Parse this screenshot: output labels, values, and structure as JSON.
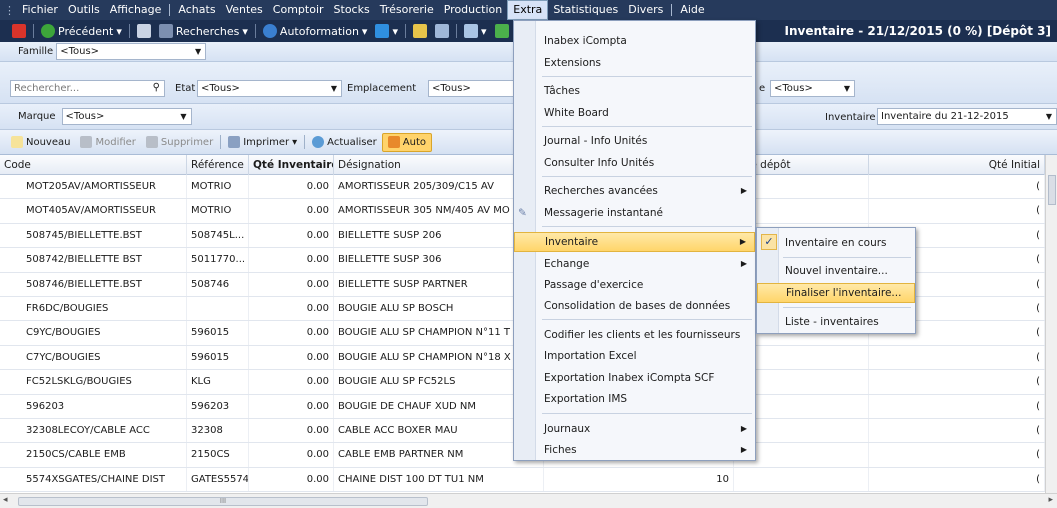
{
  "menubar": {
    "items": [
      "Fichier",
      "Outils",
      "Affichage",
      "Achats",
      "Ventes",
      "Comptoir",
      "Stocks",
      "Trésorerie",
      "Production",
      "Extra",
      "Statistiques",
      "Divers",
      "Aide"
    ]
  },
  "toolbar": {
    "back_label": "Précédent",
    "search_label": "Recherches",
    "autoformation_label": "Autoformation",
    "window_title": "Inventaire - 21/12/2015 (0 %) [Dépôt 3]"
  },
  "filters": {
    "famille_label": "Famille",
    "famille_value": "<Tous>",
    "search_placeholder": "Rechercher...",
    "etat_label": "Etat",
    "etat_value": "<Tous>",
    "emplacement_label": "Emplacement",
    "emplacement_value": "<Tous>",
    "other_value": "<Tous>",
    "marque_label": "Marque",
    "marque_value": "<Tous>",
    "inventaire_label": "Inventaire",
    "inventaire_value": "Inventaire du 21-12-2015"
  },
  "actions": {
    "nouveau": "Nouveau",
    "modifier": "Modifier",
    "supprimer": "Supprimer",
    "imprimer": "Imprimer",
    "actualiser": "Actualiser",
    "auto": "Auto"
  },
  "grid": {
    "headers": {
      "code": "Code",
      "reference": "Référence",
      "qte_inventaire": "Qté Inventaire",
      "designation": "Désignation",
      "qte_depot": "Qté dépôt",
      "qte_initial": "Qté Initial"
    },
    "rows": [
      {
        "code": "MOT205AV/AMORTISSEUR",
        "ref": "MOTRIO",
        "qty": "0.00",
        "des": "AMORTISSEUR 205/309/C15 AV",
        "extra": "",
        "ini": "("
      },
      {
        "code": "MOT405AV/AMORTISSEUR",
        "ref": "MOTRIO",
        "qty": "0.00",
        "des": "AMORTISSEUR 305 NM/405 AV MO",
        "extra": "",
        "ini": "("
      },
      {
        "code": "508745/BIELLETTE.BST",
        "ref": "508745L...",
        "qty": "0.00",
        "des": "BIELLETTE SUSP 206",
        "extra": "",
        "ini": "("
      },
      {
        "code": "508742/BIELLETTE BST",
        "ref": "5011770...",
        "qty": "0.00",
        "des": "BIELLETTE SUSP 306",
        "extra": "",
        "ini": "("
      },
      {
        "code": "508746/BIELLETTE.BST",
        "ref": "508746",
        "qty": "0.00",
        "des": "BIELLETTE SUSP PARTNER",
        "extra": "",
        "ini": "("
      },
      {
        "code": "FR6DC/BOUGIES",
        "ref": "",
        "qty": "0.00",
        "des": "BOUGIE ALU SP BOSCH",
        "extra": "",
        "ini": "("
      },
      {
        "code": "C9YC/BOUGIES",
        "ref": "596015",
        "qty": "0.00",
        "des": "BOUGIE ALU SP CHAMPION N°11 T",
        "extra": "",
        "ini": "("
      },
      {
        "code": "C7YC/BOUGIES",
        "ref": "596015",
        "qty": "0.00",
        "des": "BOUGIE ALU SP CHAMPION N°18 X",
        "extra": "",
        "ini": "("
      },
      {
        "code": "FC52LSKLG/BOUGIES",
        "ref": "KLG",
        "qty": "0.00",
        "des": "BOUGIE ALU SP FC52LS",
        "extra": "",
        "ini": "("
      },
      {
        "code": "596203",
        "ref": "596203",
        "qty": "0.00",
        "des": "BOUGIE DE CHAUF XUD NM",
        "extra": "",
        "ini": "("
      },
      {
        "code": "32308LECOY/CABLE ACC",
        "ref": "32308",
        "qty": "0.00",
        "des": "CABLE ACC BOXER MAU",
        "extra": "",
        "ini": "("
      },
      {
        "code": "2150CS/CABLE EMB",
        "ref": "2150CS",
        "qty": "0.00",
        "des": "CABLE EMB PARTNER NM",
        "extra": "",
        "ini": "("
      },
      {
        "code": "5574XSGATES/CHAINE DIST",
        "ref": "GATES5574",
        "qty": "0.00",
        "des": "CHAINE DIST 100 DT TU1 NM",
        "extra": "10",
        "ini": "("
      }
    ]
  },
  "extra_menu": {
    "items": [
      "Inabex iCompta",
      "Extensions",
      "Tâches",
      "White Board",
      "Journal - Info Unités",
      "Consulter Info Unités",
      "Recherches avancées",
      "Messagerie instantané",
      "Inventaire",
      "Echange",
      "Passage d'exercice",
      "Consolidation de bases de données",
      "Codifier les clients et les fournisseurs",
      "Importation Excel",
      "Exportation Inabex iCompta SCF",
      "Exportation IMS",
      "Journaux",
      "Fiches"
    ]
  },
  "inventaire_submenu": {
    "items": [
      "Inventaire en cours",
      "Nouvel inventaire...",
      "Finaliser l'inventaire...",
      "Liste - inventaires"
    ],
    "checkmark": "✓"
  },
  "scroll": {
    "hthumb_grip": "III"
  }
}
